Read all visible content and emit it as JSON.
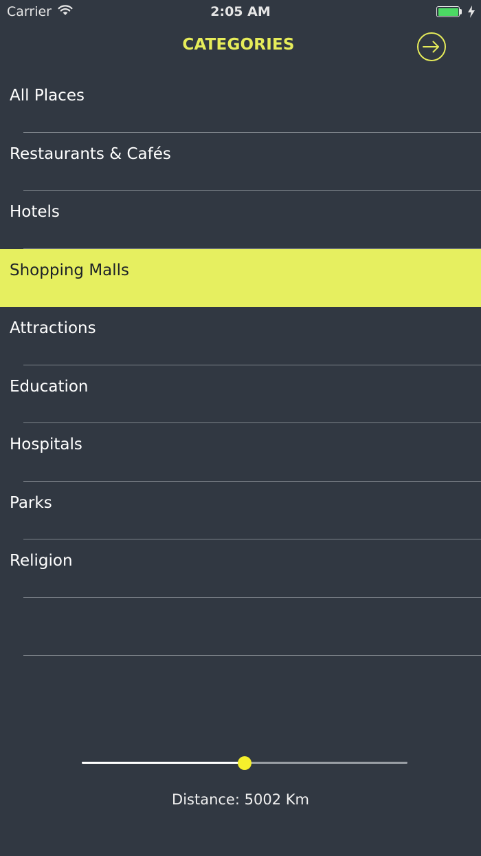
{
  "status_bar": {
    "carrier": "Carrier",
    "time": "2:05 AM",
    "battery_color": "#4cd964"
  },
  "header": {
    "title": "CATEGORIES",
    "accent_color": "#e6ec5a",
    "exit_icon": "exit-arrow-icon"
  },
  "categories": [
    {
      "label": "All Places",
      "selected": false
    },
    {
      "label": "Restaurants & Cafés",
      "selected": false
    },
    {
      "label": "Hotels",
      "selected": false
    },
    {
      "label": "Shopping Malls",
      "selected": true
    },
    {
      "label": "Attractions",
      "selected": false
    },
    {
      "label": "Education",
      "selected": false
    },
    {
      "label": "Hospitals",
      "selected": false
    },
    {
      "label": "Parks",
      "selected": false
    },
    {
      "label": "Religion",
      "selected": false
    }
  ],
  "selected_color": "#e6ef60",
  "distance_slider": {
    "fraction": 0.5,
    "thumb_color": "#f5f02c"
  },
  "distance_text": "Distance: 5002 Km"
}
